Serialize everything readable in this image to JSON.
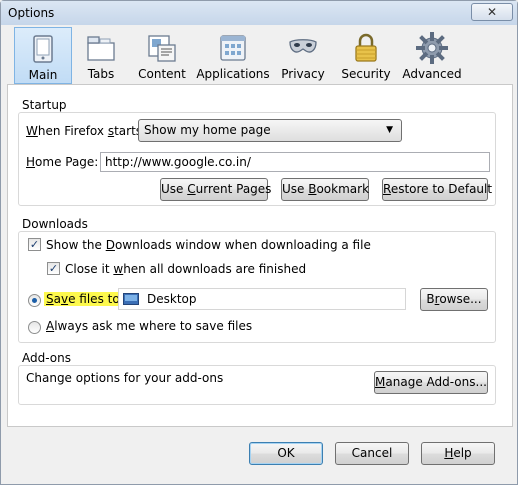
{
  "window": {
    "title": "Options",
    "close_glyph": "✕"
  },
  "toolbar": {
    "panes": [
      {
        "label": "Main",
        "icon": "main-icon",
        "selected": true
      },
      {
        "label": "Tabs",
        "icon": "tabs-icon"
      },
      {
        "label": "Content",
        "icon": "content-icon"
      },
      {
        "label": "Applications",
        "icon": "applications-icon"
      },
      {
        "label": "Privacy",
        "icon": "privacy-mask-icon"
      },
      {
        "label": "Security",
        "icon": "security-lock-icon"
      },
      {
        "label": "Advanced",
        "icon": "advanced-gear-icon"
      }
    ]
  },
  "startup": {
    "group_title": "Startup",
    "when_starts_label": "When Firefox starts:",
    "when_starts_value": "Show my home page",
    "home_page_label": "Home Page:",
    "home_page_value": "http://www.google.co.in/",
    "use_current_pages": "Use Current Pages",
    "use_bookmark": "Use Bookmark",
    "restore_default": "Restore to Default"
  },
  "downloads": {
    "group_title": "Downloads",
    "show_window_label": "Show the Downloads window when downloading a file",
    "show_window_checked": true,
    "close_it_label": "Close it when all downloads are finished",
    "close_it_checked": true,
    "save_files_label": "Save files to",
    "save_files_selected": true,
    "save_location": "Desktop",
    "browse_label": "Browse...",
    "always_ask_label": "Always ask me where to save files",
    "highlight_color": "#fdf94d"
  },
  "addons": {
    "group_title": "Add-ons",
    "description": "Change options for your add-ons",
    "manage_label": "Manage Add-ons..."
  },
  "footer": {
    "ok": "OK",
    "cancel": "Cancel",
    "help": "Help"
  }
}
